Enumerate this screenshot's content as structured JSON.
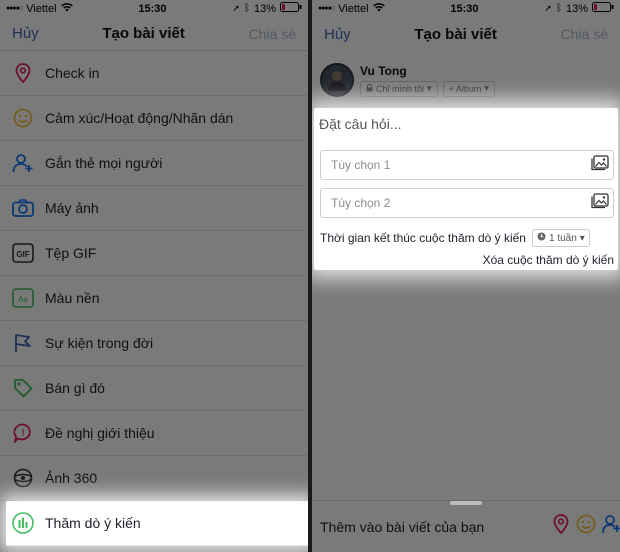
{
  "status": {
    "carrier": "Viettel",
    "time": "15:30",
    "battery": "13%"
  },
  "nav": {
    "cancel": "Hủy",
    "title": "Tạo bài viết",
    "share": "Chia sẻ"
  },
  "menu": [
    {
      "label": "Check in",
      "icon": "location-pin-icon",
      "color": "#e0245e"
    },
    {
      "label": "Cảm xúc/Hoạt động/Nhãn dán",
      "icon": "smiley-icon",
      "color": "#f5c33b"
    },
    {
      "label": "Gắn thẻ mọi người",
      "icon": "tag-people-icon",
      "color": "#1877f2"
    },
    {
      "label": "Máy ảnh",
      "icon": "camera-icon",
      "color": "#1877f2"
    },
    {
      "label": "Tệp GIF",
      "icon": "gif-icon",
      "color": "#333333"
    },
    {
      "label": "Màu nền",
      "icon": "background-color-icon",
      "color": "#45bd62"
    },
    {
      "label": "Sự kiện trong đời",
      "icon": "flag-icon",
      "color": "#4267b2"
    },
    {
      "label": "Bán gì đó",
      "icon": "price-tag-icon",
      "color": "#45bd62"
    },
    {
      "label": "Đề nghị giới thiệu",
      "icon": "recommendation-icon",
      "color": "#e0245e"
    },
    {
      "label": "Ảnh 360",
      "icon": "photo-360-icon",
      "color": "#333333"
    },
    {
      "label": "Thăm dò ý kiến",
      "icon": "poll-icon",
      "color": "#45bd62"
    }
  ],
  "profile": {
    "name": "Vu Tong",
    "privacy": "Chỉ mình tôi",
    "album": "+ Album"
  },
  "poll": {
    "question_placeholder": "Đặt câu hỏi...",
    "option1_placeholder": "Tùy chọn 1",
    "option2_placeholder": "Tùy chọn 2",
    "end_label": "Thời gian kết thúc cuộc thăm dò ý kiến",
    "duration": "1 tuần",
    "remove": "Xóa cuộc thăm dò ý kiến"
  },
  "bottom": {
    "add_to_post": "Thêm vào bài viết của bạn"
  }
}
